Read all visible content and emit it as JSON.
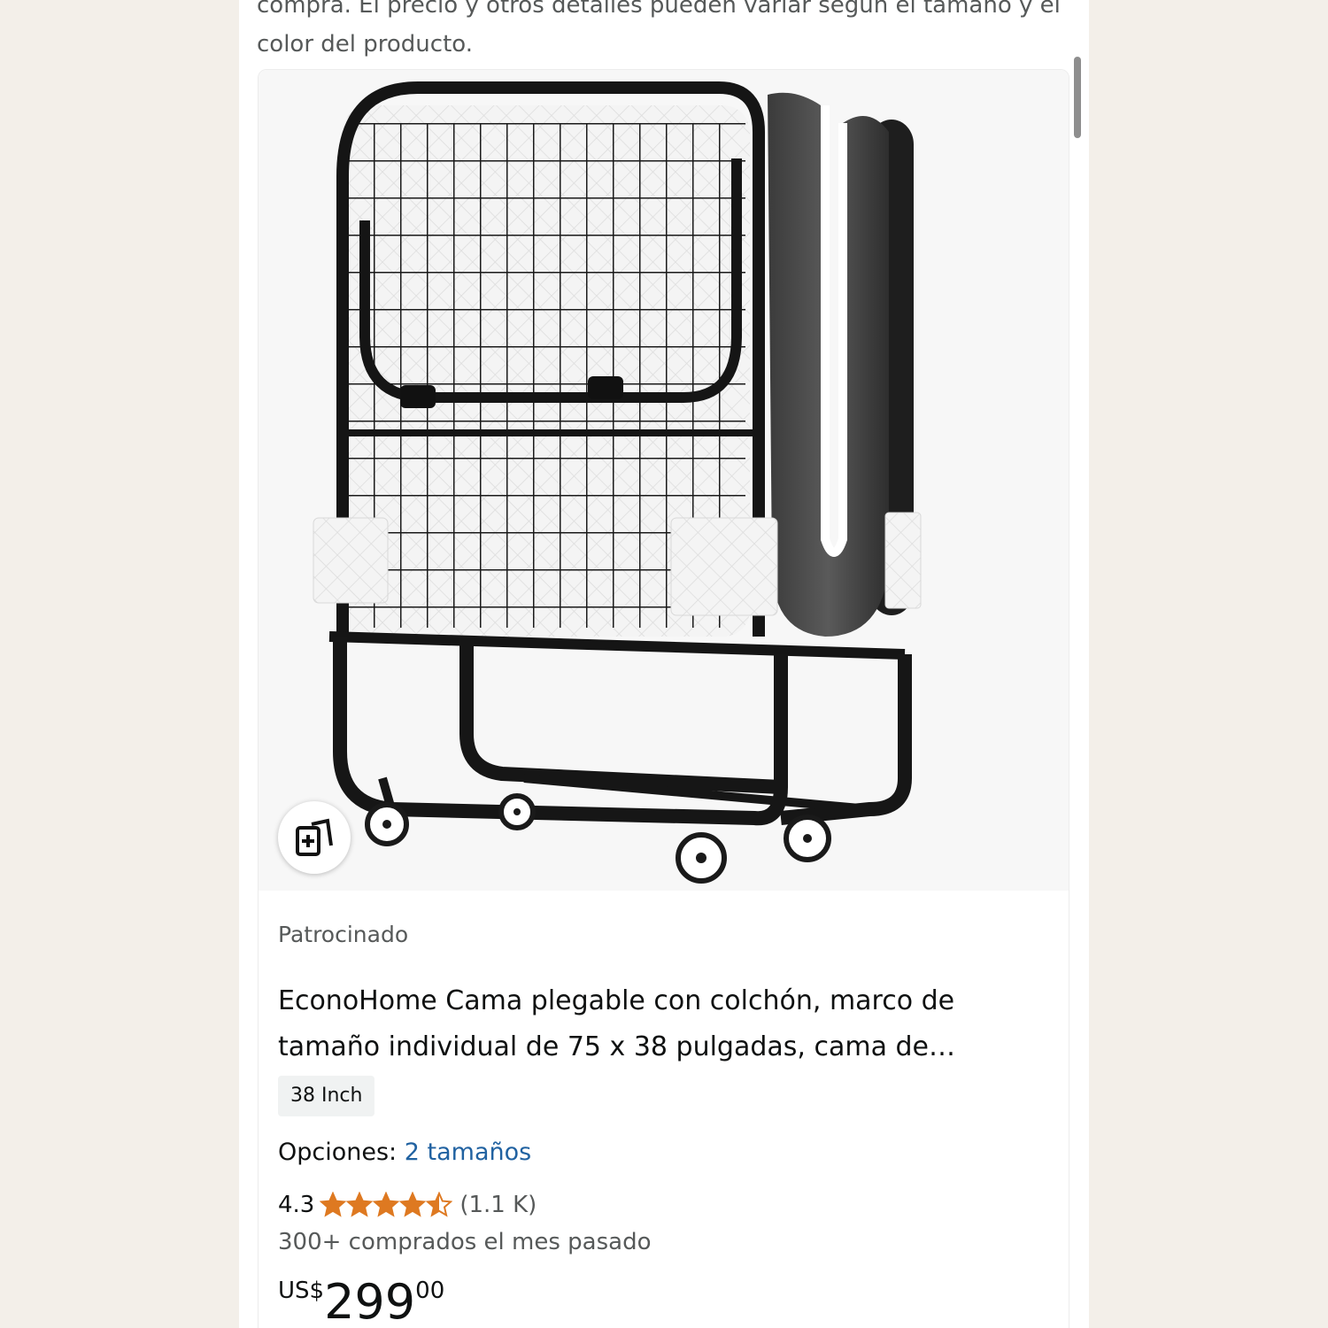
{
  "intro_text": "compra. El precio y otros detalles pueden variar según el tamaño y el color del producto.",
  "product": {
    "image_alt": "Cama plegable con colchón sobre ruedas",
    "action_icon": "add-to-compare-icon",
    "sponsored_label": "Patrocinado",
    "title": "EconoHome Cama plegable con colchón, marco de tamaño individual de 75 x 38 pulgadas, cama de…",
    "size_badge": "38 Inch",
    "options_label": "Opciones:",
    "options_link": "2 tamaños",
    "rating": "4.3",
    "stars_out_of_5": 4.5,
    "review_count": "(1.1 K)",
    "bought_text": "300+ comprados el mes pasado",
    "price_currency": "US$",
    "price_whole": "299",
    "price_fraction": "00"
  },
  "colors": {
    "link": "#2162a1",
    "star": "#de7921",
    "secondary_text": "#565959"
  }
}
